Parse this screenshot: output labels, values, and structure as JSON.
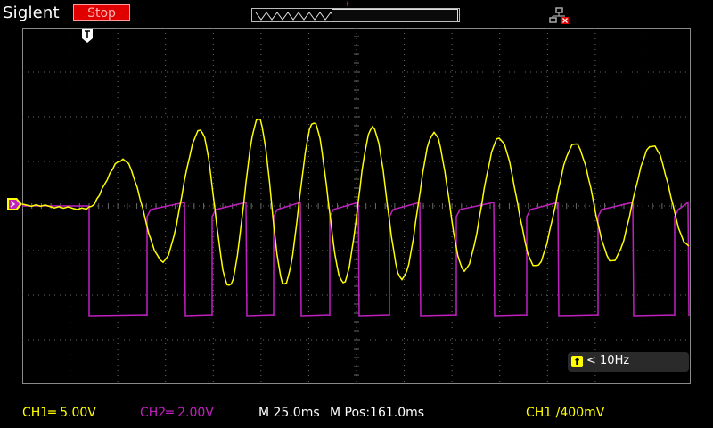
{
  "header": {
    "brand": "Siglent",
    "run_state": "Stop",
    "overview_label": "waveform-overview",
    "trigger_position_marker": "+",
    "trigger_flag": "T"
  },
  "colors": {
    "ch1": "#ffff00",
    "ch2": "#c020c0",
    "grid": "#6a6a6a",
    "stop": "#e00000"
  },
  "measurement": {
    "freq_badge": "f",
    "freq_text": "< 10Hz"
  },
  "status_bar": {
    "ch1": "CH1═ 5.00V",
    "ch2": "CH2═ 2.00V",
    "timebase": "M 25.0ms",
    "mpos": "M Pos:161.0ms",
    "trigger": "CH1 ∕400mV"
  },
  "icons": {
    "usb": "usb-connection-icon",
    "channel_marker": "channel-ground-marker-icon",
    "trigger": "trigger-position-icon"
  }
}
